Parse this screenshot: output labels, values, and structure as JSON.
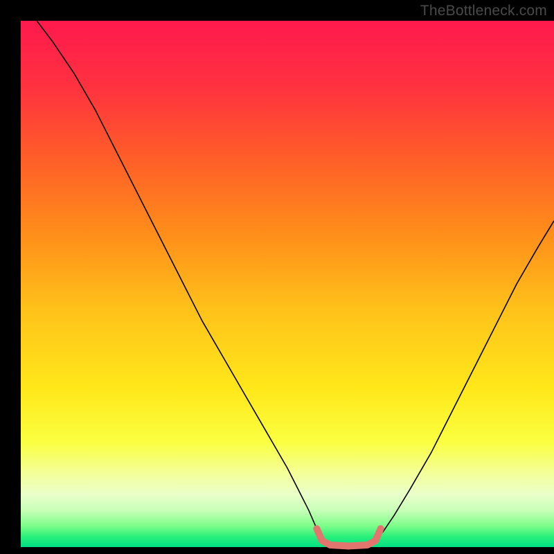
{
  "watermark": "TheBottleneck.com",
  "chart_data": {
    "type": "line",
    "title": "",
    "xlabel": "",
    "ylabel": "",
    "xlim": [
      0,
      100
    ],
    "ylim": [
      0,
      100
    ],
    "grid": false,
    "legend": false,
    "gradient_stops": [
      {
        "offset": 0,
        "color": "#ff1a4d"
      },
      {
        "offset": 12,
        "color": "#ff3040"
      },
      {
        "offset": 25,
        "color": "#ff5a2a"
      },
      {
        "offset": 40,
        "color": "#ff8c1a"
      },
      {
        "offset": 55,
        "color": "#ffc21a"
      },
      {
        "offset": 70,
        "color": "#ffe81a"
      },
      {
        "offset": 80,
        "color": "#faff40"
      },
      {
        "offset": 86,
        "color": "#f4ff9a"
      },
      {
        "offset": 90,
        "color": "#eaffca"
      },
      {
        "offset": 93,
        "color": "#c8ffb8"
      },
      {
        "offset": 96,
        "color": "#7dfd8a"
      },
      {
        "offset": 98,
        "color": "#2af07a"
      },
      {
        "offset": 100,
        "color": "#00e085"
      }
    ],
    "series": [
      {
        "name": "bottleneck-curve-left",
        "stroke": "#000000",
        "stroke_width": 1.6,
        "x": [
          3,
          6,
          10,
          14,
          18,
          22,
          26,
          30,
          34,
          38,
          42,
          46,
          50,
          52,
          54,
          55.5,
          56.5
        ],
        "y": [
          100,
          96,
          90,
          83,
          75,
          67,
          59,
          51,
          43,
          36,
          29,
          22,
          15,
          11,
          7,
          3.5,
          1.2
        ]
      },
      {
        "name": "bottleneck-curve-right",
        "stroke": "#000000",
        "stroke_width": 1.6,
        "x": [
          66.5,
          68,
          70,
          73,
          77,
          81,
          85,
          89,
          93,
          97,
          100
        ],
        "y": [
          1.2,
          3,
          6,
          11,
          18,
          26,
          34,
          42,
          50,
          57,
          62
        ]
      },
      {
        "name": "sweet-spot-band",
        "stroke": "#e2766f",
        "stroke_width": 10,
        "linecap": "round",
        "x": [
          55.5,
          56.5,
          58,
          61.5,
          65,
          66.5,
          67.5
        ],
        "y": [
          3.5,
          1.2,
          0.4,
          0.2,
          0.4,
          1.2,
          3.5
        ]
      }
    ]
  }
}
